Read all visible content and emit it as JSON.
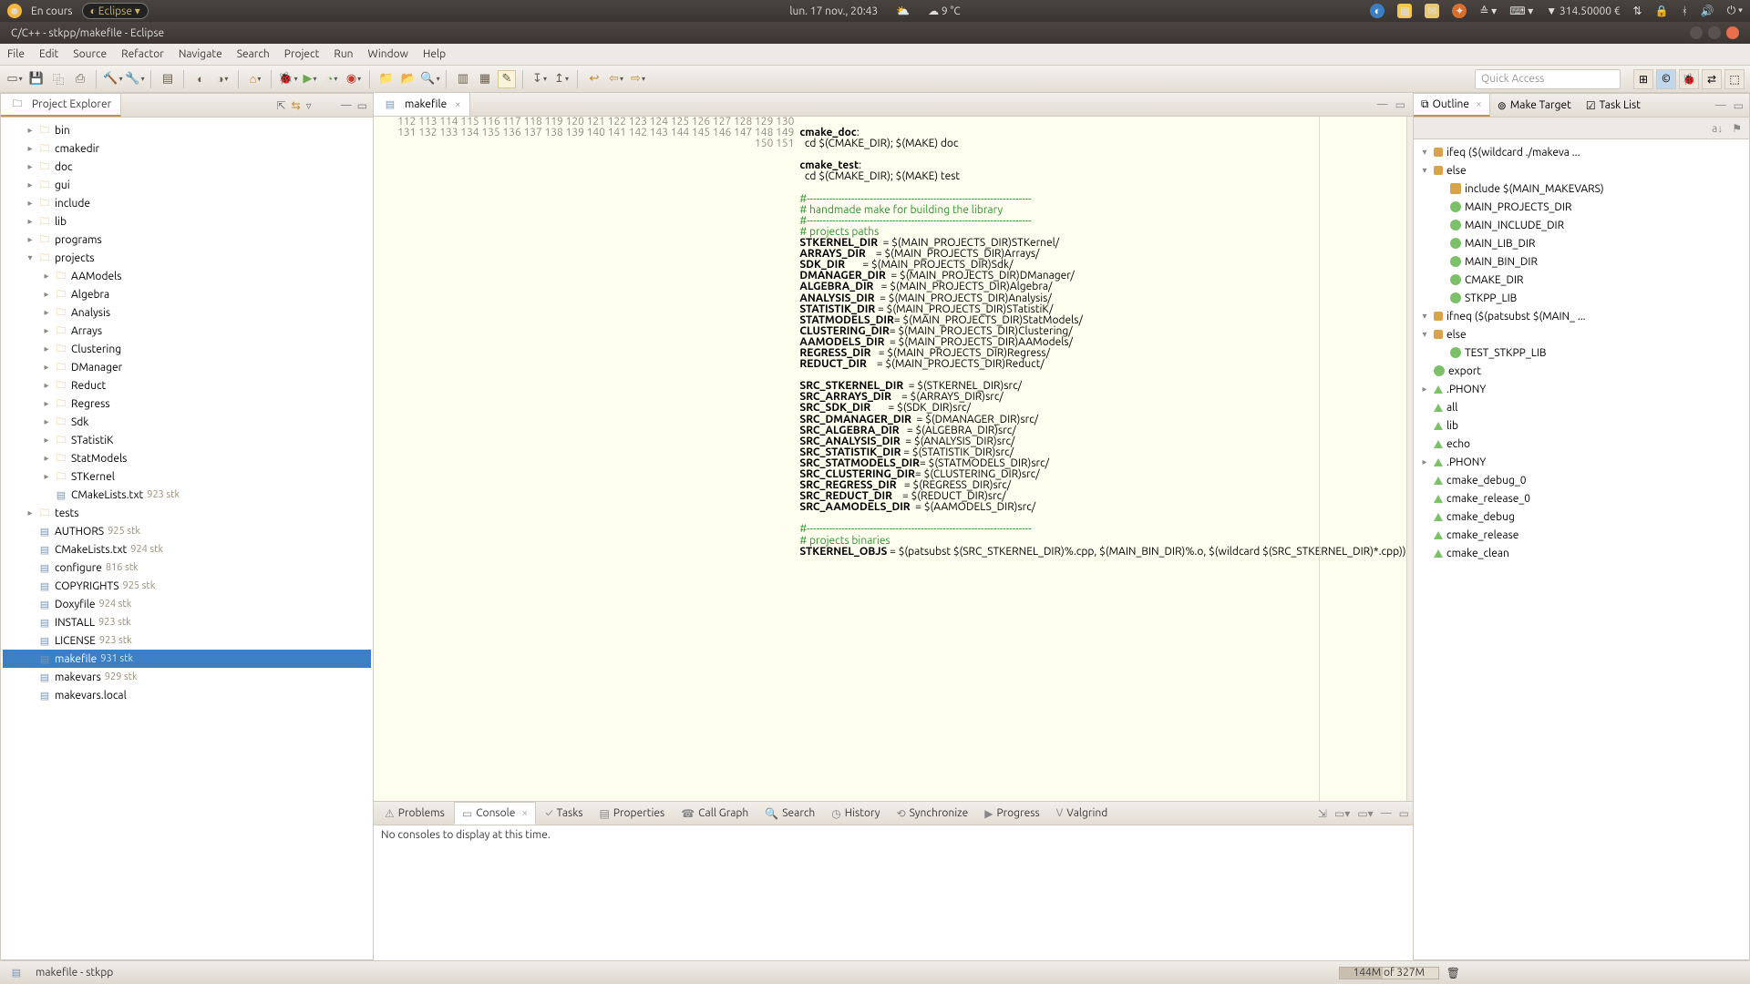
{
  "topbar": {
    "activity": "En cours",
    "eclipse": "Eclipse ▾",
    "clock": "lun. 17 nov., 20:43",
    "temp": "9 °C",
    "net": "▼ 314.50000 €"
  },
  "window": {
    "title": "C/C++ - stkpp/makefile - Eclipse"
  },
  "menu": [
    "File",
    "Edit",
    "Source",
    "Refactor",
    "Navigate",
    "Search",
    "Project",
    "Run",
    "Window",
    "Help"
  ],
  "quickaccess": "Quick Access",
  "explorer": {
    "title": "Project Explorer",
    "items": [
      {
        "d": 1,
        "exp": "+",
        "type": "fold",
        "label": "bin"
      },
      {
        "d": 1,
        "exp": "+",
        "type": "fold",
        "label": "cmakedir"
      },
      {
        "d": 1,
        "exp": "+",
        "type": "fold",
        "label": "doc"
      },
      {
        "d": 1,
        "exp": "+",
        "type": "fold",
        "label": "gui"
      },
      {
        "d": 1,
        "exp": "+",
        "type": "fold",
        "label": "include"
      },
      {
        "d": 1,
        "exp": "+",
        "type": "fold",
        "label": "lib"
      },
      {
        "d": 1,
        "exp": "+",
        "type": "fold",
        "label": "programs"
      },
      {
        "d": 1,
        "exp": "-",
        "type": "fold",
        "label": "projects"
      },
      {
        "d": 2,
        "exp": "+",
        "type": "fold",
        "label": "AAModels"
      },
      {
        "d": 2,
        "exp": "+",
        "type": "fold",
        "label": "Algebra"
      },
      {
        "d": 2,
        "exp": "+",
        "type": "fold",
        "label": "Analysis"
      },
      {
        "d": 2,
        "exp": "+",
        "type": "fold",
        "label": "Arrays"
      },
      {
        "d": 2,
        "exp": "+",
        "type": "fold",
        "label": "Clustering"
      },
      {
        "d": 2,
        "exp": "+",
        "type": "fold",
        "label": "DManager"
      },
      {
        "d": 2,
        "exp": "+",
        "type": "fold",
        "label": "Reduct"
      },
      {
        "d": 2,
        "exp": "+",
        "type": "fold",
        "label": "Regress"
      },
      {
        "d": 2,
        "exp": "+",
        "type": "fold",
        "label": "Sdk"
      },
      {
        "d": 2,
        "exp": "+",
        "type": "fold",
        "label": "STatistiK"
      },
      {
        "d": 2,
        "exp": "+",
        "type": "fold",
        "label": "StatModels"
      },
      {
        "d": 2,
        "exp": "+",
        "type": "fold",
        "label": "STKernel"
      },
      {
        "d": 2,
        "exp": "",
        "type": "file",
        "label": "CMakeLists.txt",
        "rev": "923  stk"
      },
      {
        "d": 1,
        "exp": "+",
        "type": "fold",
        "label": "tests"
      },
      {
        "d": 1,
        "exp": "",
        "type": "file",
        "label": "AUTHORS",
        "rev": "925  stk"
      },
      {
        "d": 1,
        "exp": "",
        "type": "file",
        "label": "CMakeLists.txt",
        "rev": "924  stk"
      },
      {
        "d": 1,
        "exp": "",
        "type": "file",
        "label": "configure",
        "rev": "816  stk"
      },
      {
        "d": 1,
        "exp": "",
        "type": "file",
        "label": "COPYRIGHTS",
        "rev": "925  stk"
      },
      {
        "d": 1,
        "exp": "",
        "type": "file",
        "label": "Doxyfile",
        "rev": "924  stk"
      },
      {
        "d": 1,
        "exp": "",
        "type": "file",
        "label": "INSTALL",
        "rev": "923  stk"
      },
      {
        "d": 1,
        "exp": "",
        "type": "file",
        "label": "LICENSE",
        "rev": "923  stk"
      },
      {
        "d": 1,
        "exp": "",
        "type": "file",
        "label": "makefile",
        "rev": "931  stk",
        "sel": true
      },
      {
        "d": 1,
        "exp": "",
        "type": "file",
        "label": "makevars",
        "rev": "929  stk"
      },
      {
        "d": 1,
        "exp": "",
        "type": "file",
        "label": "makevars.local"
      }
    ]
  },
  "editor": {
    "tab": "makefile",
    "first_line": 112,
    "lines": [
      {
        "t": ""
      },
      {
        "t": "cmake_doc:",
        "b": true
      },
      {
        "t": "  cd $(CMAKE_DIR); $(MAKE) doc"
      },
      {
        "t": ""
      },
      {
        "t": "cmake_test:",
        "b": true
      },
      {
        "t": "  cd $(CMAKE_DIR); $(MAKE) test"
      },
      {
        "t": ""
      },
      {
        "t": "#-----------------------------------------------------------------------",
        "c": true
      },
      {
        "t": "# handmade make for building the library",
        "c": true
      },
      {
        "t": "#-----------------------------------------------------------------------",
        "c": true
      },
      {
        "t": "# projects paths",
        "c": true
      },
      {
        "t": "STKERNEL_DIR  = $(MAIN_PROJECTS_DIR)STKernel/",
        "pb": "STKERNEL_DIR"
      },
      {
        "t": "ARRAYS_DIR    = $(MAIN_PROJECTS_DIR)Arrays/",
        "pb": "ARRAYS_DIR"
      },
      {
        "t": "SDK_DIR       = $(MAIN_PROJECTS_DIR)Sdk/",
        "pb": "SDK_DIR"
      },
      {
        "t": "DMANAGER_DIR  = $(MAIN_PROJECTS_DIR)DManager/",
        "pb": "DMANAGER_DIR"
      },
      {
        "t": "ALGEBRA_DIR   = $(MAIN_PROJECTS_DIR)Algebra/",
        "pb": "ALGEBRA_DIR"
      },
      {
        "t": "ANALYSIS_DIR  = $(MAIN_PROJECTS_DIR)Analysis/",
        "pb": "ANALYSIS_DIR"
      },
      {
        "t": "STATISTIK_DIR = $(MAIN_PROJECTS_DIR)STatistiK/",
        "pb": "STATISTIK_DIR"
      },
      {
        "t": "STATMODELS_DIR= $(MAIN_PROJECTS_DIR)StatModels/",
        "pb": "STATMODELS_DIR"
      },
      {
        "t": "CLUSTERING_DIR= $(MAIN_PROJECTS_DIR)Clustering/",
        "pb": "CLUSTERING_DIR"
      },
      {
        "t": "AAMODELS_DIR  = $(MAIN_PROJECTS_DIR)AAModels/",
        "pb": "AAMODELS_DIR"
      },
      {
        "t": "REGRESS_DIR   = $(MAIN_PROJECTS_DIR)Regress/",
        "pb": "REGRESS_DIR"
      },
      {
        "t": "REDUCT_DIR    = $(MAIN_PROJECTS_DIR)Reduct/",
        "pb": "REDUCT_DIR"
      },
      {
        "t": ""
      },
      {
        "t": "SRC_STKERNEL_DIR  = $(STKERNEL_DIR)src/",
        "pb": "SRC_STKERNEL_DIR"
      },
      {
        "t": "SRC_ARRAYS_DIR    = $(ARRAYS_DIR)src/",
        "pb": "SRC_ARRAYS_DIR"
      },
      {
        "t": "SRC_SDK_DIR       = $(SDK_DIR)src/",
        "pb": "SRC_SDK_DIR"
      },
      {
        "t": "SRC_DMANAGER_DIR  = $(DMANAGER_DIR)src/",
        "pb": "SRC_DMANAGER_DIR"
      },
      {
        "t": "SRC_ALGEBRA_DIR   = $(ALGEBRA_DIR)src/",
        "pb": "SRC_ALGEBRA_DIR"
      },
      {
        "t": "SRC_ANALYSIS_DIR  = $(ANALYSIS_DIR)src/",
        "pb": "SRC_ANALYSIS_DIR"
      },
      {
        "t": "SRC_STATISTIK_DIR = $(STATISTIK_DIR)src/",
        "pb": "SRC_STATISTIK_DIR"
      },
      {
        "t": "SRC_STATMODELS_DIR= $(STATMODELS_DIR)src/",
        "pb": "SRC_STATMODELS_DIR"
      },
      {
        "t": "SRC_CLUSTERING_DIR= $(CLUSTERING_DIR)src/",
        "pb": "SRC_CLUSTERING_DIR"
      },
      {
        "t": "SRC_REGRESS_DIR   = $(REGRESS_DIR)src/",
        "pb": "SRC_REGRESS_DIR"
      },
      {
        "t": "SRC_REDUCT_DIR    = $(REDUCT_DIR)src/",
        "pb": "SRC_REDUCT_DIR"
      },
      {
        "t": "SRC_AAMODELS_DIR  = $(AAMODELS_DIR)src/",
        "pb": "SRC_AAMODELS_DIR"
      },
      {
        "t": ""
      },
      {
        "t": "#-----------------------------------------------------------------------",
        "c": true
      },
      {
        "t": "# projects binaries",
        "c": true
      },
      {
        "t": "STKERNEL_OBJS = $(patsubst $(SRC_STKERNEL_DIR)%.cpp, $(MAIN_BIN_DIR)%.o, $(wildcard $(SRC_STKERNEL_DIR)*.cpp))",
        "pb": "STKERNEL_OBJS"
      }
    ]
  },
  "bottom": {
    "tabs": [
      "Problems",
      "Console",
      "Tasks",
      "Properties",
      "Call Graph",
      "Search",
      "History",
      "Synchronize",
      "Progress",
      "Valgrind"
    ],
    "active": 1,
    "msg": "No consoles to display at this time."
  },
  "outline": {
    "tabs": [
      "Outline",
      "Make Target",
      "Task List"
    ],
    "items": [
      {
        "d": 0,
        "caret": "-",
        "ico": "t",
        "label": "ifeq ($(wildcard ./makeva ..."
      },
      {
        "d": 0,
        "caret": "-",
        "ico": "t",
        "label": "else"
      },
      {
        "d": 1,
        "caret": "",
        "ico": "f",
        "label": "include $(MAIN_MAKEVARS)"
      },
      {
        "d": 1,
        "caret": "",
        "ico": "c",
        "label": "MAIN_PROJECTS_DIR"
      },
      {
        "d": 1,
        "caret": "",
        "ico": "c",
        "label": "MAIN_INCLUDE_DIR"
      },
      {
        "d": 1,
        "caret": "",
        "ico": "c",
        "label": "MAIN_LIB_DIR"
      },
      {
        "d": 1,
        "caret": "",
        "ico": "c",
        "label": "MAIN_BIN_DIR"
      },
      {
        "d": 1,
        "caret": "",
        "ico": "c",
        "label": "CMAKE_DIR"
      },
      {
        "d": 1,
        "caret": "",
        "ico": "c",
        "label": "STKPP_LIB"
      },
      {
        "d": 0,
        "caret": "-",
        "ico": "t",
        "label": "ifneq ($(patsubst $(MAIN_ ..."
      },
      {
        "d": 0,
        "caret": "-",
        "ico": "t",
        "label": "else"
      },
      {
        "d": 1,
        "caret": "",
        "ico": "c",
        "label": "TEST_STKPP_LIB"
      },
      {
        "d": 0,
        "caret": "",
        "ico": "c",
        "label": "export"
      },
      {
        "d": 0,
        "caret": "+",
        "ico": "tri",
        "label": ".PHONY"
      },
      {
        "d": 0,
        "caret": "",
        "ico": "tri",
        "label": "all"
      },
      {
        "d": 0,
        "caret": "",
        "ico": "tri",
        "label": "lib"
      },
      {
        "d": 0,
        "caret": "",
        "ico": "tri",
        "label": "echo"
      },
      {
        "d": 0,
        "caret": "+",
        "ico": "tri",
        "label": ".PHONY"
      },
      {
        "d": 0,
        "caret": "",
        "ico": "tri",
        "label": "cmake_debug_0"
      },
      {
        "d": 0,
        "caret": "",
        "ico": "tri",
        "label": "cmake_release_0"
      },
      {
        "d": 0,
        "caret": "",
        "ico": "tri",
        "label": "cmake_debug"
      },
      {
        "d": 0,
        "caret": "",
        "ico": "tri",
        "label": "cmake_release"
      },
      {
        "d": 0,
        "caret": "",
        "ico": "tri",
        "label": "cmake_clean"
      }
    ]
  },
  "status": {
    "file": "makefile - stkpp",
    "mem": "144M of 327M"
  }
}
